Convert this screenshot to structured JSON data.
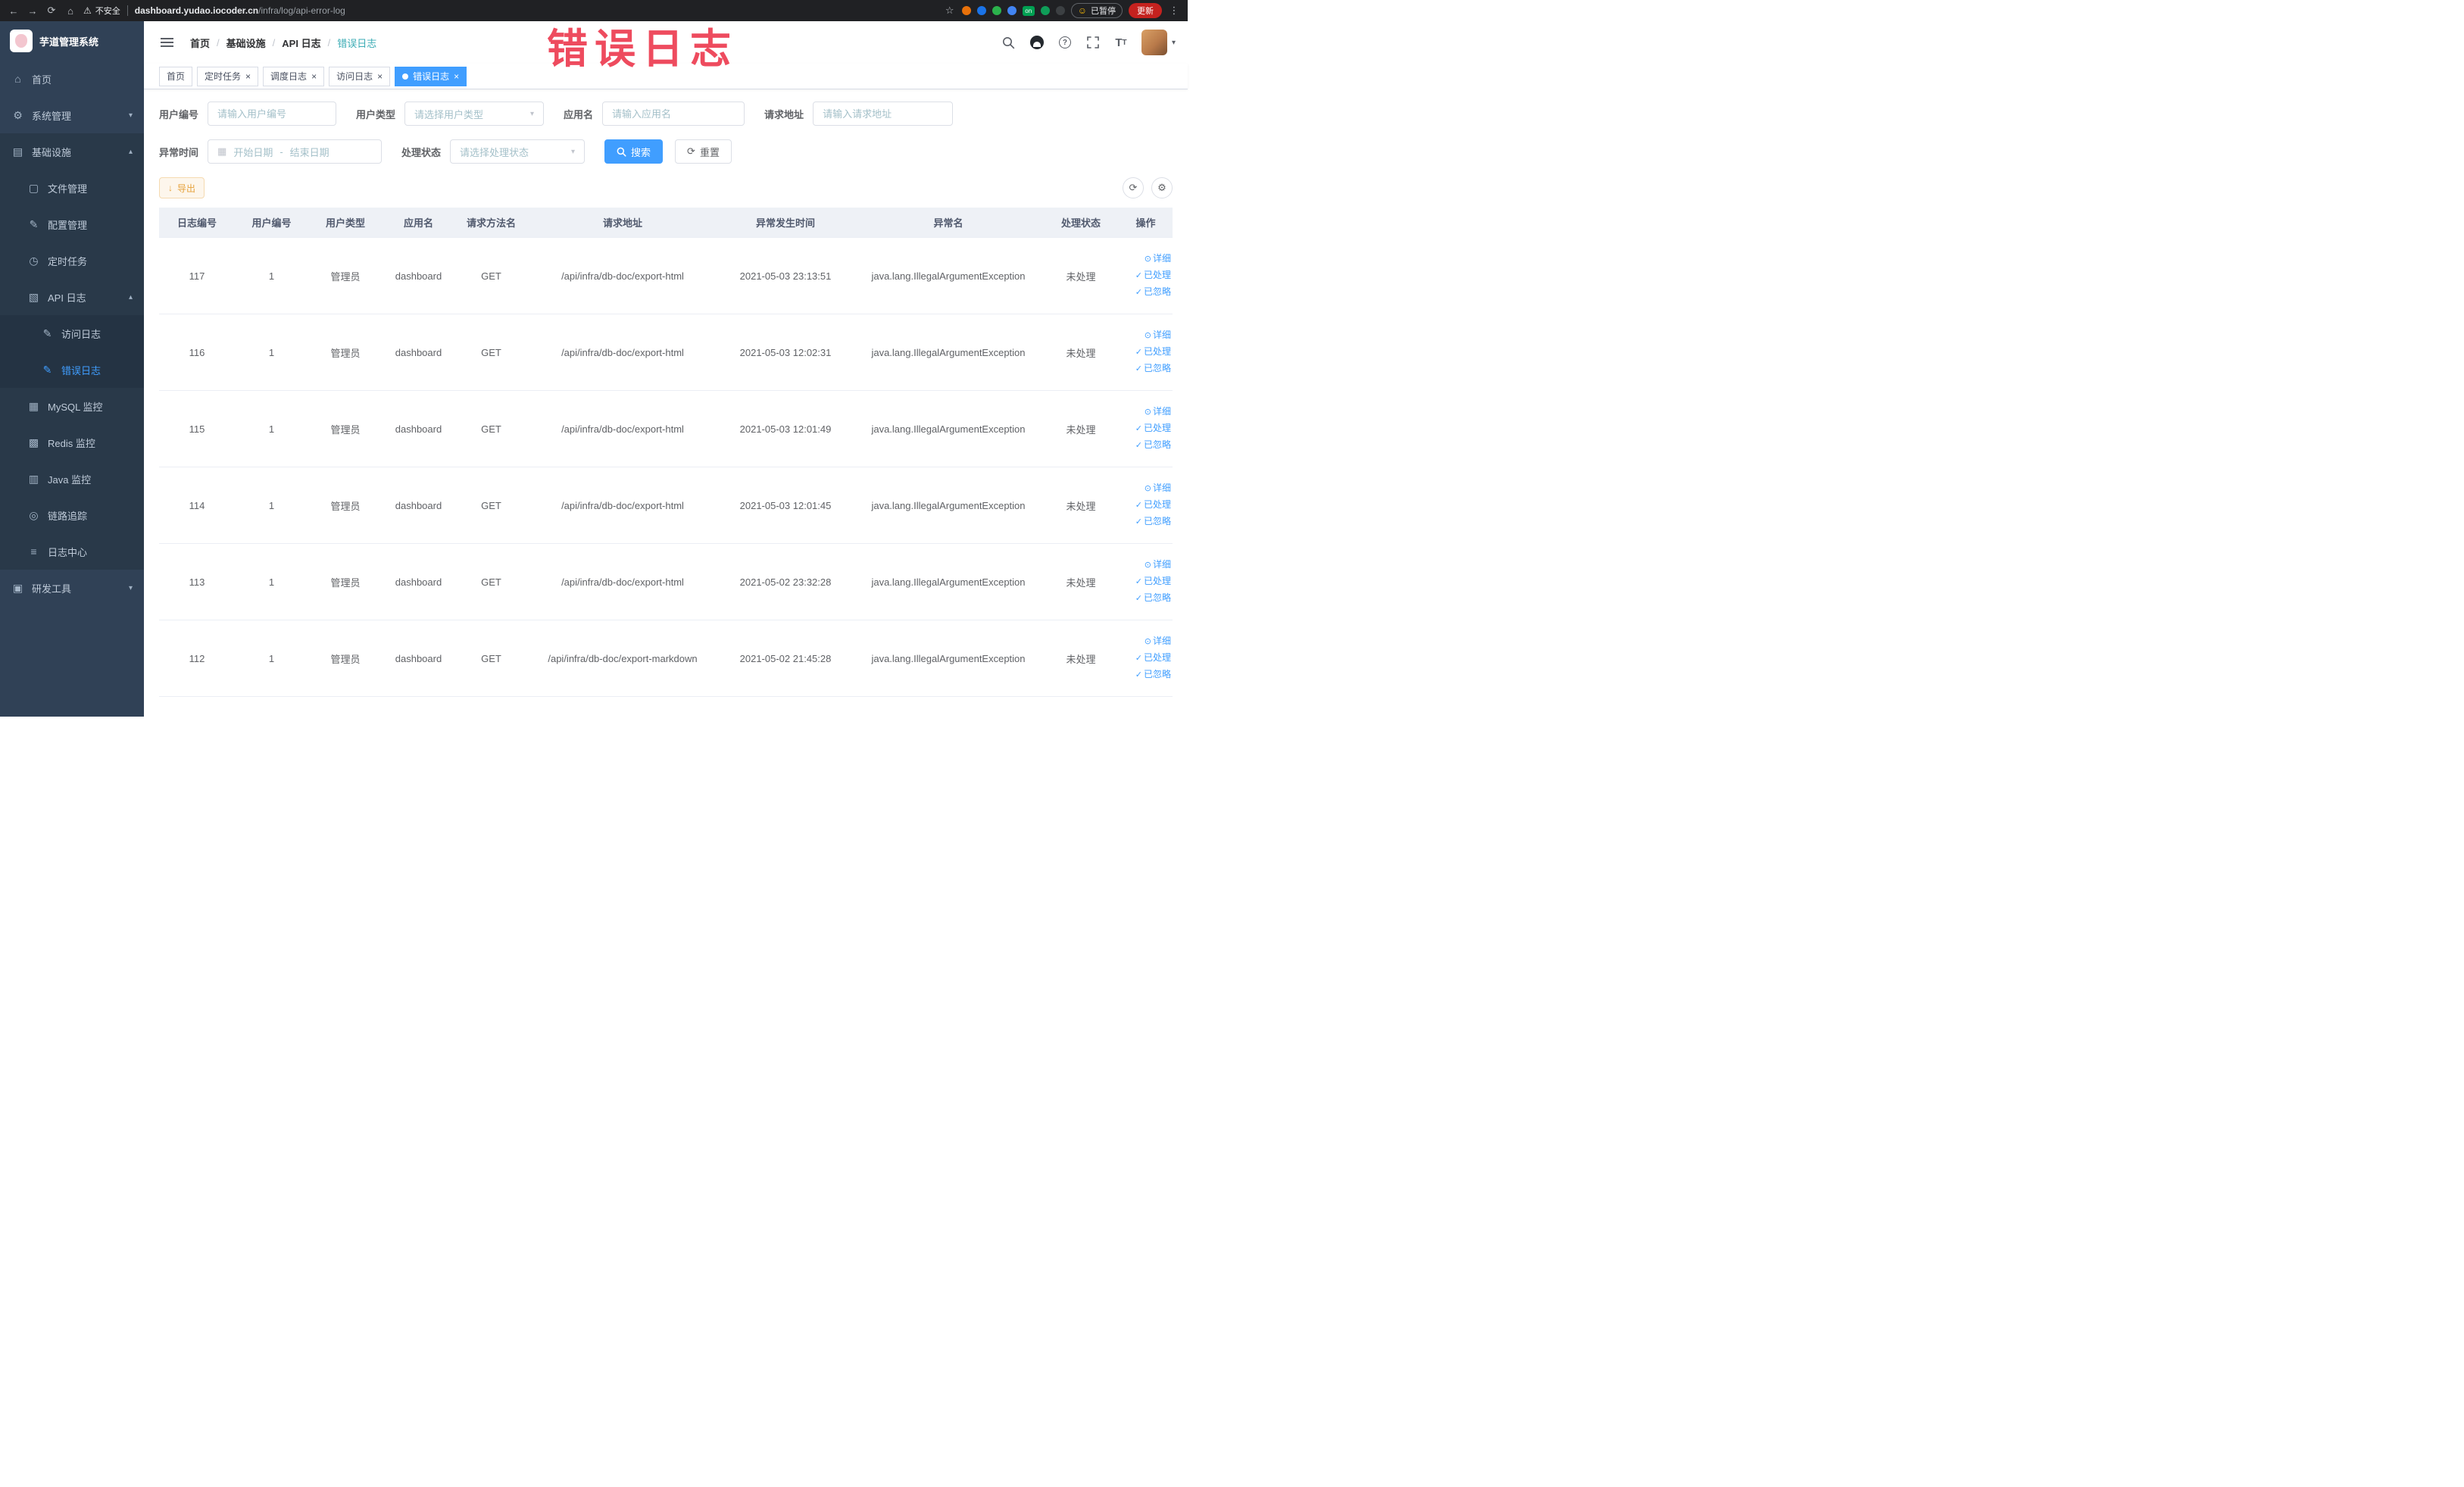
{
  "colors": {
    "accent": "#409eff",
    "warning": "#e6a23c",
    "sidebar_bg": "#304156",
    "table_header_bg": "#eef1f6",
    "overlay_red": "#ee4256",
    "active_tab_bg": "#409eff"
  },
  "icons": {
    "back": "←",
    "forward": "→",
    "reload": "⟳",
    "home_nav": "⌂",
    "warning": "⚠",
    "star": "☆",
    "kebab": "⋮",
    "smiley": "☺",
    "home": "⌂",
    "system": "⚙",
    "infra": "▤",
    "file": "▢",
    "config": "✎",
    "cron": "◷",
    "apilog": "▧",
    "access": "✎",
    "error": "✎",
    "mysql": "▦",
    "redis": "▩",
    "java": "▥",
    "trace": "◎",
    "logcenter": "≡",
    "tools": "▣",
    "chevron_down": "▾",
    "chevron_up": "▴",
    "close": "×",
    "tab_dot": "●",
    "calendar": "▦",
    "refresh": "⟳",
    "gear": "⚙",
    "eye": "⊙",
    "check": "✓",
    "download": "↓",
    "caret_down": "▾",
    "question": "?"
  },
  "browser": {
    "security_label": "不安全",
    "url_host": "dashboard.yudao.iocoder.cn",
    "url_path": "/infra/log/api-error-log",
    "paused_badge": "已暂停",
    "update_button": "更新",
    "extensions": [
      {
        "name": "extension-orange-circle",
        "style": "background:#e8710a"
      },
      {
        "name": "extension-blue-circle",
        "style": "background:#1a73e8"
      },
      {
        "name": "extension-green-circle",
        "style": "background:#2bb24c"
      },
      {
        "name": "extension-grid",
        "style": "background:#4285f4"
      },
      {
        "name": "extension-on-badge",
        "style": "background:#00a152",
        "text": "on"
      },
      {
        "name": "extension-leaf",
        "style": "background:#0f9d58"
      },
      {
        "name": "extension-dark-circle",
        "style": "background:#3c4043"
      }
    ]
  },
  "overlay_caption": "错误日志",
  "sidebar": {
    "logo_title": "芋道管理系统",
    "items": [
      {
        "label": "首页"
      },
      {
        "label": "系统管理"
      },
      {
        "label": "基础设施"
      },
      {
        "label": "文件管理"
      },
      {
        "label": "配置管理"
      },
      {
        "label": "定时任务"
      },
      {
        "label": "API 日志"
      },
      {
        "label": "访问日志"
      },
      {
        "label": "错误日志"
      },
      {
        "label": "MySQL 监控"
      },
      {
        "label": "Redis 监控"
      },
      {
        "label": "Java 监控"
      },
      {
        "label": "链路追踪"
      },
      {
        "label": "日志中心"
      },
      {
        "label": "研发工具"
      }
    ]
  },
  "header": {
    "breadcrumb": [
      "首页",
      "基础设施",
      "API 日志",
      "错误日志"
    ]
  },
  "tabs": [
    {
      "label": "首页"
    },
    {
      "label": "定时任务"
    },
    {
      "label": "调度日志"
    },
    {
      "label": "访问日志"
    },
    {
      "label": "错误日志"
    }
  ],
  "filters": {
    "user_id": {
      "label": "用户编号",
      "placeholder": "请输入用户编号"
    },
    "user_type": {
      "label": "用户类型",
      "placeholder": "请选择用户类型"
    },
    "app_name": {
      "label": "应用名",
      "placeholder": "请输入应用名"
    },
    "request_url": {
      "label": "请求地址",
      "placeholder": "请输入请求地址"
    },
    "exception_time": {
      "label": "异常时间",
      "start_placeholder": "开始日期",
      "separator": "-",
      "end_placeholder": "结束日期"
    },
    "process_status": {
      "label": "处理状态",
      "placeholder": "请选择处理状态"
    },
    "search_button": "搜索",
    "reset_button": "重置"
  },
  "toolbar": {
    "export_button": "导出"
  },
  "table": {
    "columns": [
      "日志编号",
      "用户编号",
      "用户类型",
      "应用名",
      "请求方法名",
      "请求地址",
      "异常发生时间",
      "异常名",
      "处理状态",
      "操作"
    ],
    "actions": {
      "detail": "详细",
      "processed": "已处理",
      "ignored": "已忽略"
    },
    "rows": [
      {
        "log_id": "117",
        "user_id": "1",
        "user_type": "管理员",
        "app_name": "dashboard",
        "method": "GET",
        "url": "/api/infra/db-doc/export-html",
        "time": "2021-05-03 23:13:51",
        "exception": "java.lang.IllegalArgumentException",
        "status": "未处理"
      },
      {
        "log_id": "116",
        "user_id": "1",
        "user_type": "管理员",
        "app_name": "dashboard",
        "method": "GET",
        "url": "/api/infra/db-doc/export-html",
        "time": "2021-05-03 12:02:31",
        "exception": "java.lang.IllegalArgumentException",
        "status": "未处理"
      },
      {
        "log_id": "115",
        "user_id": "1",
        "user_type": "管理员",
        "app_name": "dashboard",
        "method": "GET",
        "url": "/api/infra/db-doc/export-html",
        "time": "2021-05-03 12:01:49",
        "exception": "java.lang.IllegalArgumentException",
        "status": "未处理"
      },
      {
        "log_id": "114",
        "user_id": "1",
        "user_type": "管理员",
        "app_name": "dashboard",
        "method": "GET",
        "url": "/api/infra/db-doc/export-html",
        "time": "2021-05-03 12:01:45",
        "exception": "java.lang.IllegalArgumentException",
        "status": "未处理"
      },
      {
        "log_id": "113",
        "user_id": "1",
        "user_type": "管理员",
        "app_name": "dashboard",
        "method": "GET",
        "url": "/api/infra/db-doc/export-html",
        "time": "2021-05-02 23:32:28",
        "exception": "java.lang.IllegalArgumentException",
        "status": "未处理"
      },
      {
        "log_id": "112",
        "user_id": "1",
        "user_type": "管理员",
        "app_name": "dashboard",
        "method": "GET",
        "url": "/api/infra/db-doc/export-markdown",
        "time": "2021-05-02 21:45:28",
        "exception": "java.lang.IllegalArgumentException",
        "status": "未处理"
      }
    ]
  }
}
